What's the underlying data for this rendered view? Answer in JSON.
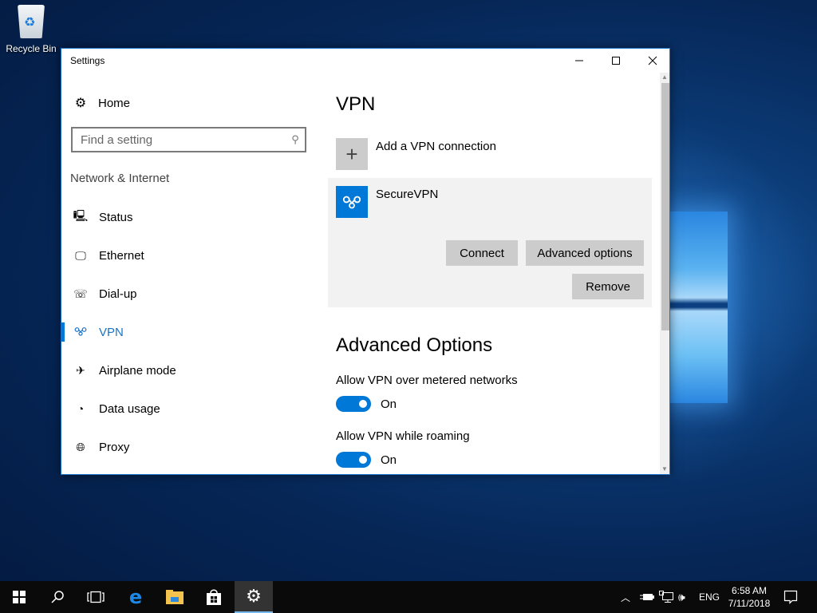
{
  "desktop": {
    "icons": [
      {
        "label": "Recycle Bin",
        "icon": "recycle-bin-icon"
      }
    ]
  },
  "window": {
    "title": "Settings",
    "controls": {
      "minimize": "—",
      "maximize": "☐",
      "close": "✕"
    }
  },
  "nav": {
    "home_label": "Home",
    "search_placeholder": "Find a setting",
    "group_title": "Network & Internet",
    "items": [
      {
        "label": "Status",
        "icon": "status-globe-icon"
      },
      {
        "label": "Ethernet",
        "icon": "ethernet-icon"
      },
      {
        "label": "Dial-up",
        "icon": "dialup-phone-icon"
      },
      {
        "label": "VPN",
        "icon": "vpn-icon",
        "active": true
      },
      {
        "label": "Airplane mode",
        "icon": "airplane-icon"
      },
      {
        "label": "Data usage",
        "icon": "data-usage-icon"
      },
      {
        "label": "Proxy",
        "icon": "proxy-globe-icon"
      }
    ]
  },
  "content": {
    "title": "VPN",
    "add_connection_label": "Add a VPN connection",
    "connection": {
      "name": "SecureVPN",
      "buttons": {
        "connect": "Connect",
        "advanced": "Advanced options",
        "remove": "Remove"
      }
    },
    "advanced_title": "Advanced Options",
    "options": [
      {
        "label": "Allow VPN over metered networks",
        "state": "On",
        "enabled": true
      },
      {
        "label": "Allow VPN while roaming",
        "state": "On",
        "enabled": true
      }
    ]
  },
  "taskbar": {
    "apps": [
      "Start",
      "Search",
      "Task View",
      "Microsoft Edge",
      "File Explorer",
      "Microsoft Store",
      "Settings"
    ],
    "tray": {
      "language": "ENG",
      "time": "6:58 AM",
      "date": "7/11/2018"
    }
  },
  "colors": {
    "accent": "#0078d7",
    "button_gray": "#cccccc",
    "card_bg": "#f2f2f2"
  }
}
